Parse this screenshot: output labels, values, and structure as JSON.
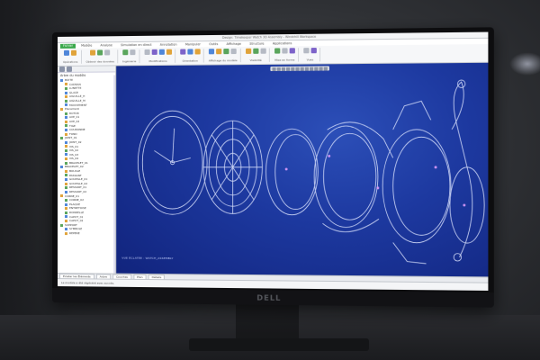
{
  "app": {
    "title": "Design: Timekeeper Watch 3D Assembly - Windchill Workspace",
    "menu_tabs": [
      "Fichier",
      "Modèle",
      "Analyse",
      "Simulation en direct",
      "Annotation",
      "Manipuler",
      "Outils",
      "Affichage",
      "Structure",
      "Applications"
    ],
    "active_tab_index": 0
  },
  "ribbon": {
    "groups": [
      {
        "label": "Opérations",
        "icons": 2
      },
      {
        "label": "Obtenir des données",
        "icons": 3
      },
      {
        "label": "Ingénierie",
        "icons": 2
      },
      {
        "label": "Modifications",
        "icons": 4
      },
      {
        "label": "Orientation",
        "icons": 3
      },
      {
        "label": "Affichage du modèle",
        "icons": 4
      },
      {
        "label": "Visibilité",
        "icons": 3
      },
      {
        "label": "Mise en forme",
        "icons": 3
      },
      {
        "label": "Vues",
        "icons": 2
      }
    ]
  },
  "model_tree": {
    "title": "Arbre du modèle",
    "rows": [
      "BOITE",
      "CADRAN",
      "LUNETTE",
      "GLACE",
      "AIGUILLE_H",
      "AIGUILLE_M",
      "MOUVEMENT",
      "Placement",
      "ROTOR",
      "AXE_01",
      "AXE_02",
      "TIGE",
      "COURONNE",
      "FOND",
      "JOINT_01",
      "JOINT_02",
      "VIS_01",
      "VIS_02",
      "VIS_03",
      "VIS_04",
      "BRACELET_01",
      "BRACELET_02",
      "BOUCLE",
      "PASSANT",
      "GOUPILLE_01",
      "GOUPILLE_02",
      "RESSORT_01",
      "RESSORT_02",
      "CORNE_01",
      "CORNE_02",
      "PLAQUE",
      "ENTRETOISE",
      "RONDELLE",
      "CAPOT_01",
      "CAPOT_02",
      "SUPPORT",
      "SYMBOLE",
      "REPERE"
    ]
  },
  "viewport": {
    "label": "VUE ÉCLATÉE - WATCH_ASSEMBLY"
  },
  "tabs": [
    "Éclater les Éléments",
    "Arbre",
    "Couches",
    "Plan",
    "Détails"
  ],
  "status": {
    "text": "Le modèle a été régénéré avec succès."
  },
  "monitor": {
    "brand": "DELL"
  },
  "colors": {
    "viewport_blue": "#1d39a0",
    "wire": "#dfe6ff",
    "accent_green": "#3aa84b",
    "highlight_pink": "#e7a0ff"
  }
}
